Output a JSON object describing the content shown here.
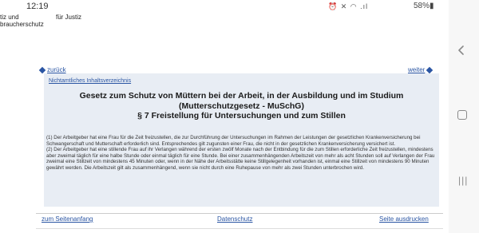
{
  "status_bar": {
    "time": "12:19",
    "icons": "⏰ ✕ ◠ .ıl",
    "battery": "58%"
  },
  "header": {
    "line1_left": "tiz und",
    "line1_right": "für Justiz",
    "line2": "braucherschutz"
  },
  "nav": {
    "back_label": "zurück",
    "next_label": "weiter"
  },
  "document": {
    "toc_link": "Nichtamtliches Inhaltsverzeichnis",
    "title_line1": "Gesetz zum Schutz von Müttern bei der Arbeit, in der Ausbildung und im Studium",
    "title_line2": "(Mutterschutzgesetz - MuSchG)",
    "section_title": "§ 7 Freistellung für Untersuchungen und zum Stillen",
    "paragraph1": "(1) Der Arbeitgeber hat eine Frau für die Zeit freizustellen, die zur Durchführung der Untersuchungen im Rahmen der Leistungen der gesetzlichen Krankenversicherung bei Schwangerschaft und Mutterschaft erforderlich sind. Entsprechendes gilt zugunsten einer Frau, die nicht in der gesetzlichen Krankenversicherung versichert ist.",
    "paragraph2": "(2) Der Arbeitgeber hat eine stillende Frau auf ihr Verlangen während der ersten zwölf Monate nach der Entbindung für die zum Stillen erforderliche Zeit freizustellen, mindestens aber zweimal täglich für eine halbe Stunde oder einmal täglich für eine Stunde. Bei einer zusammenhängenden Arbeitszeit von mehr als acht Stunden soll auf Verlangen der Frau zweimal eine Stillzeit von mindestens 45 Minuten oder, wenn in der Nähe der Arbeitsstätte keine Stillgelegenheit vorhanden ist, einmal eine Stillzeit von mindestens 90 Minuten gewährt werden. Die Arbeitszeit gilt als zusammenhängend, wenn sie nicht durch eine Ruhepause von mehr als zwei Stunden unterbrochen wird."
  },
  "footer": {
    "top_link": "zum Seitenanfang",
    "privacy_link": "Datenschutz",
    "print_link": "Seite ausdrucken"
  },
  "icons": {
    "back": "chevron-left-icon",
    "home": "home-square-icon",
    "recent": "recent-apps-icon"
  }
}
